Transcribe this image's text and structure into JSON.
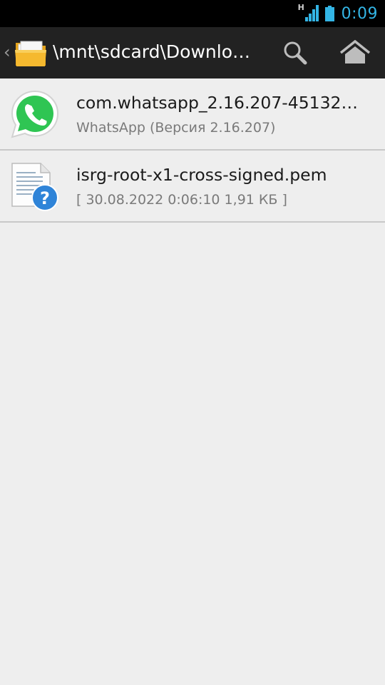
{
  "status_bar": {
    "network_type": "H",
    "clock": "0:09",
    "accent_color": "#33b5e5"
  },
  "action_bar": {
    "path": "\\mnt\\sdcard\\Downlo…",
    "icons": [
      "up-caret-icon",
      "folder-icon",
      "search-icon",
      "home-icon"
    ]
  },
  "files": [
    {
      "name": "com.whatsapp_2.16.207-45132…",
      "subtitle": "WhatsApp (Версия 2.16.207)",
      "icon": "whatsapp-icon"
    },
    {
      "name": "isrg-root-x1-cross-signed.pem",
      "subtitle": "[ 30.08.2022 0:06:10 1,91 КБ ]",
      "icon": "unknown-file-icon"
    }
  ]
}
